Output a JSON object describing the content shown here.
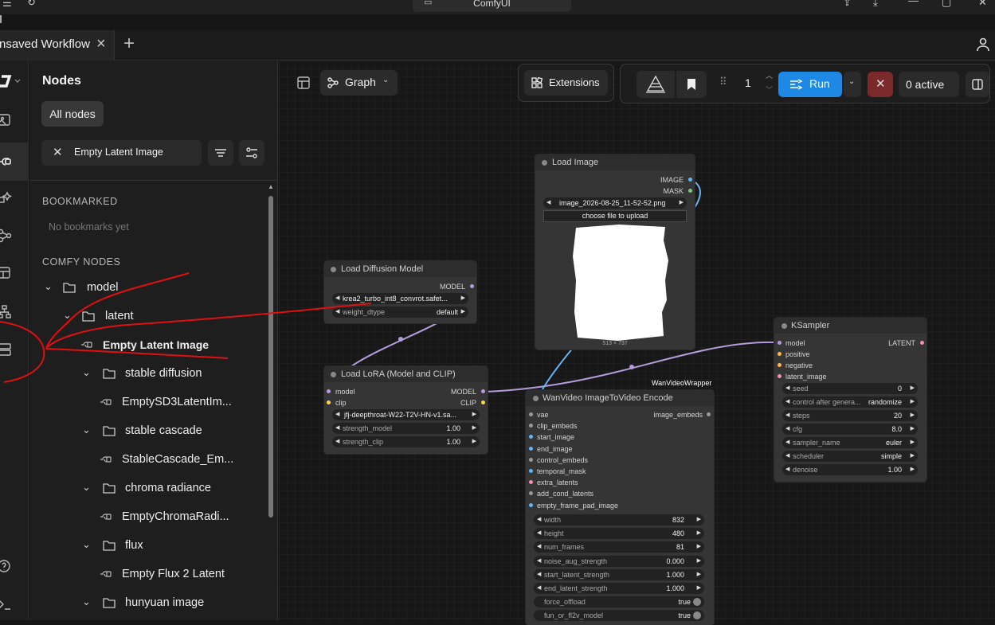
{
  "app": {
    "title": "ComfyUI"
  },
  "tab": {
    "label": "nsaved Workflow"
  },
  "sidebar": {
    "title": "Nodes",
    "all_nodes": "All nodes",
    "search_value": "Empty Latent Image",
    "bookmarked_heading": "BOOKMARKED",
    "no_bookmarks": "No bookmarks yet",
    "comfy_nodes_heading": "COMFY NODES",
    "tree": [
      {
        "label": "model"
      },
      {
        "label": "latent"
      },
      {
        "label": "Empty Latent Image"
      },
      {
        "label": "stable diffusion"
      },
      {
        "label": "EmptySD3LatentIm..."
      },
      {
        "label": "stable cascade"
      },
      {
        "label": "StableCascade_Em..."
      },
      {
        "label": "chroma radiance"
      },
      {
        "label": "EmptyChromaRadi..."
      },
      {
        "label": "flux"
      },
      {
        "label": "Empty Flux 2 Latent"
      },
      {
        "label": "hunyuan image"
      }
    ]
  },
  "toolbar": {
    "graph": "Graph",
    "extensions": "Extensions",
    "queue_count": "1",
    "run": "Run",
    "active": "0 active"
  },
  "nodes": {
    "load_image": {
      "title": "Load Image",
      "out_image": "IMAGE",
      "out_mask": "MASK",
      "filename": "image_2026-08-25_11-52-52.png",
      "upload": "choose file to upload",
      "dims": "513 × 737"
    },
    "load_diffusion": {
      "title": "Load Diffusion Model",
      "out_model": "MODEL",
      "unet_name": "krea2_turbo_int8_convrot.safet...",
      "weight_dtype_label": "weight_dtype",
      "weight_dtype_value": "default"
    },
    "load_lora": {
      "title": "Load LoRA (Model and CLIP)",
      "in_model": "model",
      "in_clip": "clip",
      "out_model": "MODEL",
      "out_clip": "CLIP",
      "lora_name": "jfj-deepthroat-W22-T2V-HN-v1.sa...",
      "strength_model_label": "strength_model",
      "strength_model_value": "1.00",
      "strength_clip_label": "strength_clip",
      "strength_clip_value": "1.00"
    },
    "wan": {
      "badge": "WanVideoWrapper",
      "title": "WanVideo ImageToVideo Encode",
      "out": "image_embeds",
      "inputs": [
        "vae",
        "clip_embeds",
        "start_image",
        "end_image",
        "control_embeds",
        "temporal_mask",
        "extra_latents",
        "add_cond_latents",
        "empty_frame_pad_image"
      ],
      "widgets": [
        {
          "label": "width",
          "value": "832"
        },
        {
          "label": "height",
          "value": "480"
        },
        {
          "label": "num_frames",
          "value": "81"
        },
        {
          "label": "noise_aug_strength",
          "value": "0.000"
        },
        {
          "label": "start_latent_strength",
          "value": "1.000"
        },
        {
          "label": "end_latent_strength",
          "value": "1.000"
        },
        {
          "label": "force_offload",
          "value": "true"
        },
        {
          "label": "fun_or_fl2v_model",
          "value": "true"
        }
      ]
    },
    "ksampler": {
      "title": "KSampler",
      "inputs": [
        "model",
        "positive",
        "negative",
        "latent_image"
      ],
      "out": "LATENT",
      "widgets": [
        {
          "label": "seed",
          "value": "0"
        },
        {
          "label": "control after genera...",
          "value": "randomize"
        },
        {
          "label": "steps",
          "value": "20"
        },
        {
          "label": "cfg",
          "value": "8.0"
        },
        {
          "label": "sampler_name",
          "value": "euler"
        },
        {
          "label": "scheduler",
          "value": "simple"
        },
        {
          "label": "denoise",
          "value": "1.00"
        }
      ]
    }
  },
  "colors": {
    "run_button": "#1e88e5",
    "cancel_button": "#7a2a2a",
    "annotation": "#e01010",
    "link_model": "#b39ddb",
    "link_image": "#64b5f6"
  }
}
